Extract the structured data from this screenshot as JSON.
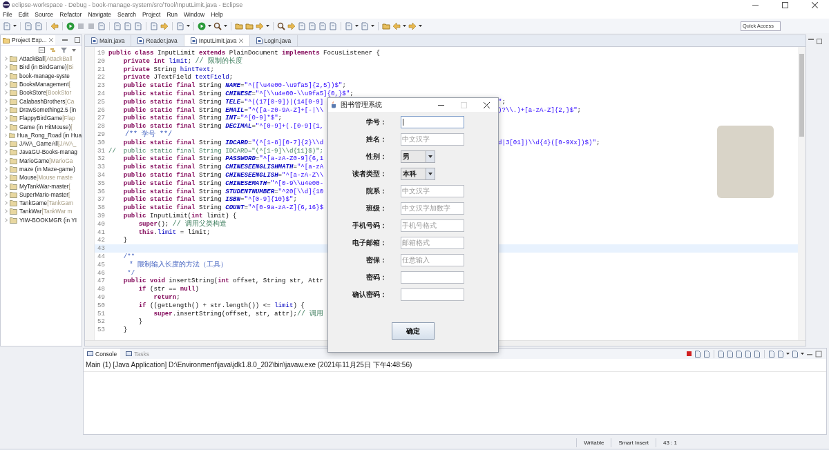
{
  "window": {
    "title": "eclipse-workspace - Debug - book-manage-system/src/Tool/InputLimit.java - Eclipse"
  },
  "menu": [
    "File",
    "Edit",
    "Source",
    "Refactor",
    "Navigate",
    "Search",
    "Project",
    "Run",
    "Window",
    "Help"
  ],
  "quick_access": {
    "placeholder": "Quick Access"
  },
  "project_explorer": {
    "title": "Project Exp...",
    "items": [
      {
        "name": "AttackBall",
        "decoration": "[AttackBall"
      },
      {
        "name": "Bird (in BirdGame)",
        "decoration": "[Bi"
      },
      {
        "name": "book-manage-syste"
      },
      {
        "name": "BooksManagement",
        "decoration": "["
      },
      {
        "name": "BookStore",
        "decoration": "[BookStor"
      },
      {
        "name": "CalabashBrothers",
        "decoration": "[Ca"
      },
      {
        "name": "DrawSomething2.5 (in"
      },
      {
        "name": "FlappyBirdGame",
        "decoration": "[Flap"
      },
      {
        "name": "Game (in HitMouse)",
        "decoration": "["
      },
      {
        "name": "Hua_Rong_Road (in Hua"
      },
      {
        "name": "JAVA_GameAll",
        "decoration": "[JAVA_"
      },
      {
        "name": "JavaGU-Books-manag"
      },
      {
        "name": "MarioGame",
        "decoration": "[MarioGa"
      },
      {
        "name": "maze (in Maze-game)"
      },
      {
        "name": "Mouse",
        "decoration": "[Mouse maste"
      },
      {
        "name": "MyTankWar-master",
        "decoration": "["
      },
      {
        "name": "SuperMario-master",
        "decoration": "["
      },
      {
        "name": "TankGame",
        "decoration": "[TankGam"
      },
      {
        "name": "TankWar",
        "decoration": "[TankWar m"
      },
      {
        "name": "YIW-BOOKMGR (in YI"
      }
    ]
  },
  "editor_tabs": [
    {
      "label": "Main.java",
      "selected": false
    },
    {
      "label": "Reader.java",
      "selected": false
    },
    {
      "label": "InputLimit.java",
      "selected": true
    },
    {
      "label": "Login.java",
      "selected": false
    }
  ],
  "code": [
    {
      "number": "19",
      "current": false,
      "segments": [
        {
          "kind": "kw",
          "text": "public class"
        },
        {
          "kind": "plain",
          "text": " InputLimit "
        },
        {
          "kind": "kw",
          "text": "extends"
        },
        {
          "kind": "plain",
          "text": " PlainDocument "
        },
        {
          "kind": "kw",
          "text": "implements"
        },
        {
          "kind": "plain",
          "text": " FocusListener {"
        }
      ]
    },
    {
      "number": "20",
      "current": false,
      "segments": [
        {
          "kind": "kw",
          "text": "    private int "
        },
        {
          "kind": "field",
          "text": "limit"
        },
        {
          "kind": "plain",
          "text": "; "
        },
        {
          "kind": "cmt_zh",
          "text": "// 限制的长度"
        }
      ]
    },
    {
      "number": "21",
      "current": false,
      "segments": [
        {
          "kind": "kw",
          "text": "    private"
        },
        {
          "kind": "plain",
          "text": " String "
        },
        {
          "kind": "field",
          "text": "hintText"
        },
        {
          "kind": "plain",
          "text": ";"
        }
      ]
    },
    {
      "number": "22",
      "current": false,
      "segments": [
        {
          "kind": "kw",
          "text": "    private"
        },
        {
          "kind": "plain",
          "text": " JTextField "
        },
        {
          "kind": "field",
          "text": "textField"
        },
        {
          "kind": "plain",
          "text": ";"
        }
      ]
    },
    {
      "number": "23",
      "current": false,
      "segments": [
        {
          "kind": "kw",
          "text": "    public static final"
        },
        {
          "kind": "plain",
          "text": " String "
        },
        {
          "kind": "const",
          "text": "NAME"
        },
        {
          "kind": "plain",
          "text": "="
        },
        {
          "kind": "str",
          "text": "\"^([\\u4e00-\\u9fa5]{2,5})$\""
        },
        {
          "kind": "plain",
          "text": ";"
        }
      ]
    },
    {
      "number": "24",
      "current": false,
      "segments": [
        {
          "kind": "kw",
          "text": "    public static final"
        },
        {
          "kind": "plain",
          "text": " String "
        },
        {
          "kind": "const",
          "text": "CHINESE"
        },
        {
          "kind": "plain",
          "text": "="
        },
        {
          "kind": "str",
          "text": "\"^[\\\\u4e00-\\\\u9fa5]{0,}$\""
        },
        {
          "kind": "plain",
          "text": ";"
        }
      ]
    },
    {
      "number": "25",
      "current": false,
      "segments": [
        {
          "kind": "kw",
          "text": "    public static final"
        },
        {
          "kind": "plain",
          "text": " String "
        },
        {
          "kind": "const",
          "text": "TELE"
        },
        {
          "kind": "plain",
          "text": "="
        },
        {
          "kind": "str",
          "text": "\"^((17[0-9])|(14[0-9]"
        }
      ],
      "tail": [
        {
          "kind": "str",
          "text": "\""
        },
        {
          "kind": "plain",
          "text": ";"
        }
      ]
    },
    {
      "number": "26",
      "current": false,
      "segments": [
        {
          "kind": "kw",
          "text": "    public static final"
        },
        {
          "kind": "plain",
          "text": " String "
        },
        {
          "kind": "const",
          "text": "EMAIL"
        },
        {
          "kind": "plain",
          "text": "="
        },
        {
          "kind": "str",
          "text": "\"^([a-z0-9A-Z]+[-|\\\\"
        }
      ],
      "tail": [
        {
          "kind": "str",
          "text": ")?\\\\.)+[a-zA-Z]{2,}$\""
        },
        {
          "kind": "plain",
          "text": ";"
        }
      ]
    },
    {
      "number": "27",
      "current": false,
      "segments": [
        {
          "kind": "kw",
          "text": "    public static final"
        },
        {
          "kind": "plain",
          "text": " String "
        },
        {
          "kind": "const",
          "text": "INT"
        },
        {
          "kind": "plain",
          "text": "="
        },
        {
          "kind": "str",
          "text": "\"^[0-9]*$\""
        },
        {
          "kind": "plain",
          "text": ";"
        }
      ]
    },
    {
      "number": "28",
      "current": false,
      "segments": [
        {
          "kind": "kw",
          "text": "    public static final"
        },
        {
          "kind": "plain",
          "text": " String "
        },
        {
          "kind": "const",
          "text": "DECIMAL"
        },
        {
          "kind": "plain",
          "text": "="
        },
        {
          "kind": "str",
          "text": "\"^[0-9]+(.[0-9]{1,"
        }
      ]
    },
    {
      "number": "29",
      "current": false,
      "segments": [
        {
          "kind": "doc_zh",
          "text": "    /** 学号 **/"
        }
      ]
    },
    {
      "number": "30",
      "current": false,
      "segments": [
        {
          "kind": "kw",
          "text": "    public static final"
        },
        {
          "kind": "plain",
          "text": " String "
        },
        {
          "kind": "const",
          "text": "IDCARD"
        },
        {
          "kind": "plain",
          "text": "="
        },
        {
          "kind": "str",
          "text": "\"(^[1-8][0-7]{2}\\\\d"
        }
      ],
      "tail": [
        {
          "kind": "str",
          "text": "d|3[01])\\\\d{4}([0-9Xx])$)\""
        },
        {
          "kind": "plain",
          "text": ";"
        }
      ]
    },
    {
      "number": "31",
      "current": false,
      "segments": [
        {
          "kind": "cmt",
          "text": "//  public static final String IDCARD=\"(^[1-9]\\\\d{11}$)\";"
        }
      ]
    },
    {
      "number": "32",
      "current": false,
      "segments": [
        {
          "kind": "kw",
          "text": "    public static final"
        },
        {
          "kind": "plain",
          "text": " String "
        },
        {
          "kind": "const",
          "text": "PASSWORD"
        },
        {
          "kind": "plain",
          "text": "="
        },
        {
          "kind": "str",
          "text": "\"^[a-zA-Z0-9]{6,1"
        }
      ]
    },
    {
      "number": "33",
      "current": false,
      "segments": [
        {
          "kind": "kw",
          "text": "    public static final"
        },
        {
          "kind": "plain",
          "text": " String "
        },
        {
          "kind": "const",
          "text": "CHINESEENGLISHMATH"
        },
        {
          "kind": "plain",
          "text": "="
        },
        {
          "kind": "str",
          "text": "\"^[a-zA"
        }
      ]
    },
    {
      "number": "34",
      "current": false,
      "segments": [
        {
          "kind": "kw",
          "text": "    public static final"
        },
        {
          "kind": "plain",
          "text": " String "
        },
        {
          "kind": "const",
          "text": "CHINESEENGLISH"
        },
        {
          "kind": "plain",
          "text": "="
        },
        {
          "kind": "str",
          "text": "\"^[a-zA-Z\\\\"
        }
      ]
    },
    {
      "number": "35",
      "current": false,
      "segments": [
        {
          "kind": "kw",
          "text": "    public static final"
        },
        {
          "kind": "plain",
          "text": " String "
        },
        {
          "kind": "const",
          "text": "CHINESEMATH"
        },
        {
          "kind": "plain",
          "text": "="
        },
        {
          "kind": "str",
          "text": "\"^[0-9\\\\u4e00-"
        }
      ]
    },
    {
      "number": "36",
      "current": false,
      "segments": [
        {
          "kind": "kw",
          "text": "    public static final"
        },
        {
          "kind": "plain",
          "text": " String "
        },
        {
          "kind": "const",
          "text": "STUDENTNUMBER"
        },
        {
          "kind": "plain",
          "text": "="
        },
        {
          "kind": "str",
          "text": "\"^20[\\\\d]{10"
        }
      ]
    },
    {
      "number": "37",
      "current": false,
      "segments": [
        {
          "kind": "kw",
          "text": "    public static final"
        },
        {
          "kind": "plain",
          "text": " String "
        },
        {
          "kind": "const",
          "text": "ISBN"
        },
        {
          "kind": "plain",
          "text": "="
        },
        {
          "kind": "str",
          "text": "\"^[0-9]{10}$\""
        },
        {
          "kind": "plain",
          "text": ";"
        }
      ]
    },
    {
      "number": "38",
      "current": false,
      "segments": [
        {
          "kind": "kw",
          "text": "    public static final"
        },
        {
          "kind": "plain",
          "text": " String "
        },
        {
          "kind": "const",
          "text": "COUNT"
        },
        {
          "kind": "plain",
          "text": "="
        },
        {
          "kind": "str",
          "text": "\"^[0-9a-zA-Z]{6,16}$"
        }
      ]
    },
    {
      "number": "39",
      "current": false,
      "segments": [
        {
          "kind": "kw",
          "text": "    public"
        },
        {
          "kind": "plain",
          "text": " InputLimit("
        },
        {
          "kind": "kw",
          "text": "int"
        },
        {
          "kind": "plain",
          "text": " limit) {"
        }
      ]
    },
    {
      "number": "40",
      "current": false,
      "segments": [
        {
          "kind": "kw",
          "text": "        super"
        },
        {
          "kind": "plain",
          "text": "(); "
        },
        {
          "kind": "cmt_zh",
          "text": "// 调用父类构造"
        }
      ]
    },
    {
      "number": "41",
      "current": false,
      "segments": [
        {
          "kind": "kw",
          "text": "        this"
        },
        {
          "kind": "plain",
          "text": "."
        },
        {
          "kind": "field",
          "text": "limit"
        },
        {
          "kind": "plain",
          "text": " = limit;"
        }
      ]
    },
    {
      "number": "42",
      "current": false,
      "segments": [
        {
          "kind": "plain",
          "text": "    }"
        }
      ]
    },
    {
      "number": "43",
      "current": true
    },
    {
      "number": "44",
      "current": false,
      "segments": [
        {
          "kind": "doc",
          "text": "    /**"
        }
      ]
    },
    {
      "number": "45",
      "current": false,
      "segments": [
        {
          "kind": "doc_zh",
          "text": "     * 限制输入长度的方法（工具）"
        }
      ]
    },
    {
      "number": "46",
      "current": false,
      "segments": [
        {
          "kind": "doc",
          "text": "     */"
        }
      ]
    },
    {
      "number": "47",
      "current": false,
      "segments": [
        {
          "kind": "kw",
          "text": "    public void"
        },
        {
          "kind": "plain",
          "text": " insertString("
        },
        {
          "kind": "kw",
          "text": "int"
        },
        {
          "kind": "plain",
          "text": " offset, String str, Attr"
        }
      ]
    },
    {
      "number": "48",
      "current": false,
      "segments": [
        {
          "kind": "kw",
          "text": "        if"
        },
        {
          "kind": "plain",
          "text": " (str == "
        },
        {
          "kind": "kw",
          "text": "null"
        },
        {
          "kind": "plain",
          "text": ")"
        }
      ]
    },
    {
      "number": "49",
      "current": false,
      "segments": [
        {
          "kind": "kw",
          "text": "            return"
        },
        {
          "kind": "plain",
          "text": ";"
        }
      ]
    },
    {
      "number": "50",
      "current": false,
      "segments": [
        {
          "kind": "kw",
          "text": "        if"
        },
        {
          "kind": "plain",
          "text": " ((getLength() + str.length()) <= "
        },
        {
          "kind": "field",
          "text": "limit"
        },
        {
          "kind": "plain",
          "text": ") {"
        }
      ]
    },
    {
      "number": "51",
      "current": false,
      "segments": [
        {
          "kind": "kw",
          "text": "            super"
        },
        {
          "kind": "plain",
          "text": ".insertString(offset, str, attr);"
        },
        {
          "kind": "cmt_zh",
          "text": "// 调用"
        }
      ]
    },
    {
      "number": "52",
      "current": false,
      "segments": [
        {
          "kind": "plain",
          "text": "        }"
        }
      ]
    },
    {
      "number": "53",
      "current": false,
      "segments": [
        {
          "kind": "plain",
          "text": "    }"
        }
      ]
    }
  ],
  "dialog": {
    "title": "图书管理系统",
    "fields": [
      {
        "kind": "text",
        "label": "学号：",
        "focused": true
      },
      {
        "kind": "text",
        "label": "姓名：",
        "placeholder": "中文汉字",
        "focused": false
      },
      {
        "kind": "combo",
        "label": "性别：",
        "value": "男",
        "focused": false
      },
      {
        "kind": "combo",
        "label": "读者类型：",
        "value": "本科",
        "focused": false
      },
      {
        "kind": "text",
        "label": "院系：",
        "placeholder": "中文汉字",
        "focused": false
      },
      {
        "kind": "text",
        "label": "班级：",
        "placeholder": "中文汉字加数字",
        "focused": false
      },
      {
        "kind": "text",
        "label": "手机号码：",
        "placeholder": "手机号格式",
        "focused": false
      },
      {
        "kind": "text",
        "label": "电子邮箱：",
        "placeholder": "邮箱格式",
        "focused": false
      },
      {
        "kind": "text",
        "label": "密保：",
        "placeholder": "任意输入",
        "focused": false
      },
      {
        "kind": "text",
        "label": "密码：",
        "focused": false
      },
      {
        "kind": "text",
        "label": "确认密码：",
        "focused": false
      }
    ],
    "button": "确定"
  },
  "console": {
    "tabs": [
      {
        "label": "Console",
        "selected": true
      },
      {
        "label": "Tasks",
        "selected": false
      }
    ],
    "process": "Main (1) [Java Application] D:\\Environment\\java\\jdk1.8.0_202\\bin\\javaw.exe (2021年11月25日 下午4:48:56)"
  },
  "status_bar": [
    "Writable",
    "Smart Insert",
    "43 : 1"
  ]
}
